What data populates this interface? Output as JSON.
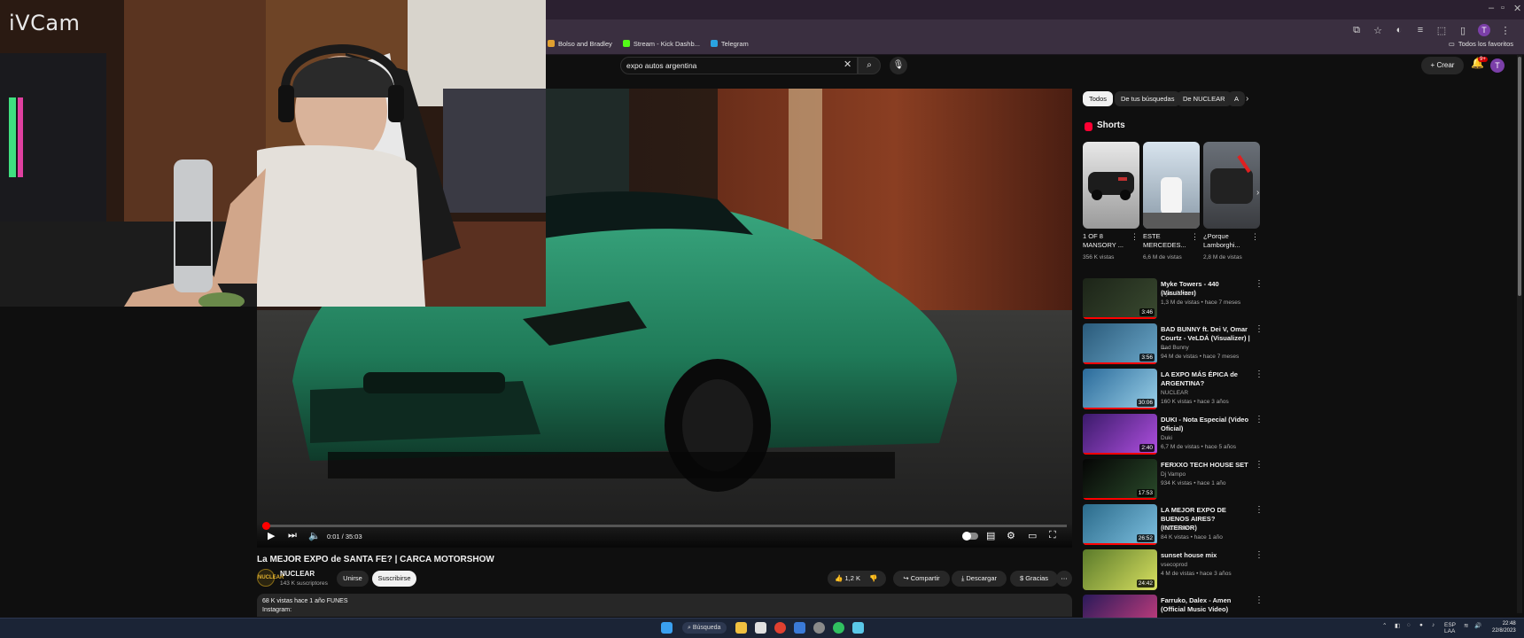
{
  "app": {
    "overlay_logo": "iVCam"
  },
  "browser": {
    "bookmarks": [
      {
        "label": "Bolso and Bradley",
        "color": "#e0a030"
      },
      {
        "label": "Stream - Kick Dashb...",
        "color": "#53fc18"
      },
      {
        "label": "Telegram",
        "color": "#2aa3e0"
      }
    ],
    "all_bookmarks_label": "Todos los favoritos",
    "profile_initial": "T"
  },
  "header": {
    "search_value": "expo autos argentina",
    "create_label": "Crear",
    "notif_count": "9+",
    "avatar_initial": "T"
  },
  "player": {
    "progress_fraction": 0.0005,
    "time_label": "0:01 / 35:03"
  },
  "video": {
    "title": "La MEJOR EXPO de SANTA FE? | CARCA MOTORSHOW",
    "channel_name": "NUCLEAR",
    "channel_subs": "143 K suscriptores",
    "channel_avatar_text": "NUCLEAR",
    "join_label": "Unirse",
    "subscribe_label": "Suscribirse",
    "like_count": "1,2 K",
    "share_label": "Compartir",
    "download_label": "Descargar",
    "thanks_label": "Gracias",
    "desc_stats": "68 K vistas  hace 1 año  FUNES",
    "desc_line2": "Instagram:"
  },
  "sidebar": {
    "chips": [
      "Todos",
      "De tus búsquedas",
      "De NUCLEAR",
      "A"
    ],
    "shorts_label": "Shorts",
    "shorts": [
      {
        "title": "1 OF 8 MANSORY ...",
        "views": "356 K vistas"
      },
      {
        "title": "ESTE MERCEDES...",
        "views": "6,6 M de vistas"
      },
      {
        "title": "¿Porque Lamborghi...",
        "views": "2,8 M de vistas"
      }
    ],
    "recommendations": [
      {
        "title": "Myke Towers - 440 (Visualizer)",
        "channel": "Myke Towers",
        "meta": "1,3 M de vistas • hace 7 meses",
        "duration": "3:46",
        "colors": [
          "#1c2418",
          "#3a4a30"
        ]
      },
      {
        "title": "BAD BUNNY ft. Dei V, Omar Courtz - VeLDÁ (Visualizer) | ...",
        "channel": "Bad Bunny",
        "meta": "94 M de vistas • hace 7 meses",
        "duration": "3:56",
        "colors": [
          "#2a5a7a",
          "#6aa6c8"
        ]
      },
      {
        "title": "LA EXPO MÁS ÉPICA de ARGENTINA?",
        "channel": "NUCLEAR",
        "meta": "160 K vistas • hace 3 años",
        "duration": "30:06",
        "colors": [
          "#2a6a9a",
          "#9ad0e8"
        ]
      },
      {
        "title": "DUKI - Nota Especial (Video Oficial)",
        "channel": "Duki",
        "meta": "6,7 M de vistas • hace 5 años",
        "duration": "2:40",
        "colors": [
          "#3a1a6a",
          "#b050e0"
        ]
      },
      {
        "title": "FERXXO TECH HOUSE SET",
        "channel": "Dj Vampo",
        "meta": "934 K vistas • hace 1 año",
        "duration": "17:53",
        "colors": [
          "#050505",
          "#2a4a2a"
        ]
      },
      {
        "title": "LA MEJOR EXPO DE BUENOS AIRES? (INTERIOR)",
        "channel": "NUCLEAR",
        "meta": "84 K vistas • hace 1 año",
        "duration": "26:52",
        "colors": [
          "#2a6a8a",
          "#7ec0e0"
        ]
      },
      {
        "title": "sunset house mix",
        "channel": "vsecoprod",
        "meta": "4 M de vistas • hace 3 años",
        "duration": "24:42",
        "colors": [
          "#5a7a2a",
          "#d8e060"
        ]
      },
      {
        "title": "Farruko, Dalex - Amen (Official Music Video)",
        "channel": "",
        "meta": "",
        "duration": "",
        "colors": [
          "#2a1a5a",
          "#d04080"
        ]
      }
    ]
  },
  "taskbar": {
    "search_label": "Búsqueda",
    "lang": "ESP",
    "lang2": "LAA",
    "time": "22:48",
    "date": "22/8/2023"
  }
}
